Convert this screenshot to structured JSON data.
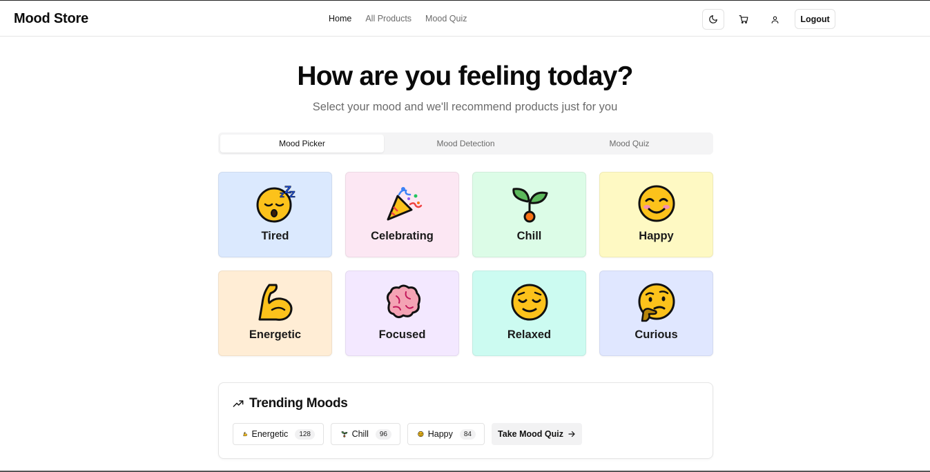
{
  "header": {
    "brand": "Mood Store",
    "nav": [
      {
        "label": "Home",
        "active": true
      },
      {
        "label": "All Products",
        "active": false
      },
      {
        "label": "Mood Quiz",
        "active": false
      }
    ],
    "icons": {
      "theme": "moon-icon",
      "cart": "cart-icon",
      "user": "user-icon"
    },
    "logout_label": "Logout"
  },
  "hero": {
    "title": "How are you feeling today?",
    "subtitle": "Select your mood and we'll recommend products just for you"
  },
  "tabs": [
    {
      "label": "Mood Picker",
      "active": true
    },
    {
      "label": "Mood Detection",
      "active": false
    },
    {
      "label": "Mood Quiz",
      "active": false
    }
  ],
  "moods": [
    {
      "label": "Tired",
      "icon": "sleeping-face-icon",
      "color": "#dbe9fe"
    },
    {
      "label": "Celebrating",
      "icon": "party-popper-icon",
      "color": "#fce7f3"
    },
    {
      "label": "Chill",
      "icon": "seedling-icon",
      "color": "#dcfce7"
    },
    {
      "label": "Happy",
      "icon": "smiling-face-icon",
      "color": "#fef9c3"
    },
    {
      "label": "Energetic",
      "icon": "flexed-biceps-icon",
      "color": "#ffedd5"
    },
    {
      "label": "Focused",
      "icon": "brain-icon",
      "color": "#f3e8ff"
    },
    {
      "label": "Relaxed",
      "icon": "relieved-face-icon",
      "color": "#ccfbf1"
    },
    {
      "label": "Curious",
      "icon": "thinking-face-icon",
      "color": "#e0e7ff"
    }
  ],
  "trending": {
    "title": "Trending Moods",
    "icon": "trending-up-icon",
    "items": [
      {
        "label": "Energetic",
        "count": "128",
        "icon": "flexed-biceps-icon"
      },
      {
        "label": "Chill",
        "count": "96",
        "icon": "seedling-icon"
      },
      {
        "label": "Happy",
        "count": "84",
        "icon": "smiling-face-icon"
      }
    ],
    "quiz_button": "Take Mood Quiz"
  }
}
